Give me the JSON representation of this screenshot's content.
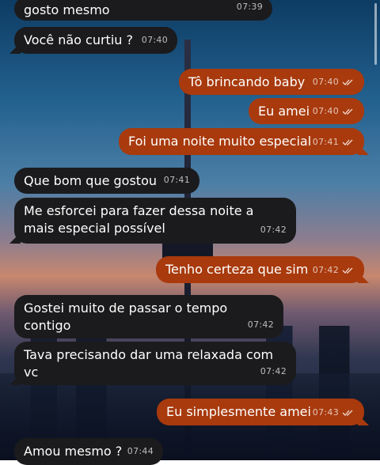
{
  "messages": [
    {
      "dir": "in",
      "text": "gosto mesmo",
      "time": "07:39"
    },
    {
      "dir": "in",
      "text": "Você não curtiu ?",
      "time": "07:40"
    },
    {
      "dir": "out",
      "text": "Tô brincando baby",
      "time": "07:40"
    },
    {
      "dir": "out",
      "text": "Eu amei",
      "time": "07:40"
    },
    {
      "dir": "out",
      "text": "Foi uma noite muito especial",
      "time": "07:41"
    },
    {
      "dir": "in",
      "text": "Que bom que gostou",
      "time": "07:41"
    },
    {
      "dir": "in",
      "text": "Me esforcei para fazer dessa noite a mais especial possível",
      "time": "07:42"
    },
    {
      "dir": "out",
      "text": "Tenho certeza que sim",
      "time": "07:42"
    },
    {
      "dir": "in",
      "text": "Gostei muito de passar o tempo contigo",
      "time": "07:42"
    },
    {
      "dir": "in",
      "text": "Tava precisando dar uma relaxada com vc",
      "time": "07:42"
    },
    {
      "dir": "out",
      "text": "Eu simplesmente amei",
      "time": "07:43"
    },
    {
      "dir": "in",
      "text": "Amou mesmo ?",
      "time": "07:44"
    }
  ],
  "colors": {
    "incoming": "#1b1b1d",
    "outgoing": "#a83a0d"
  },
  "icons": {
    "read_receipt": "double-check-icon"
  }
}
